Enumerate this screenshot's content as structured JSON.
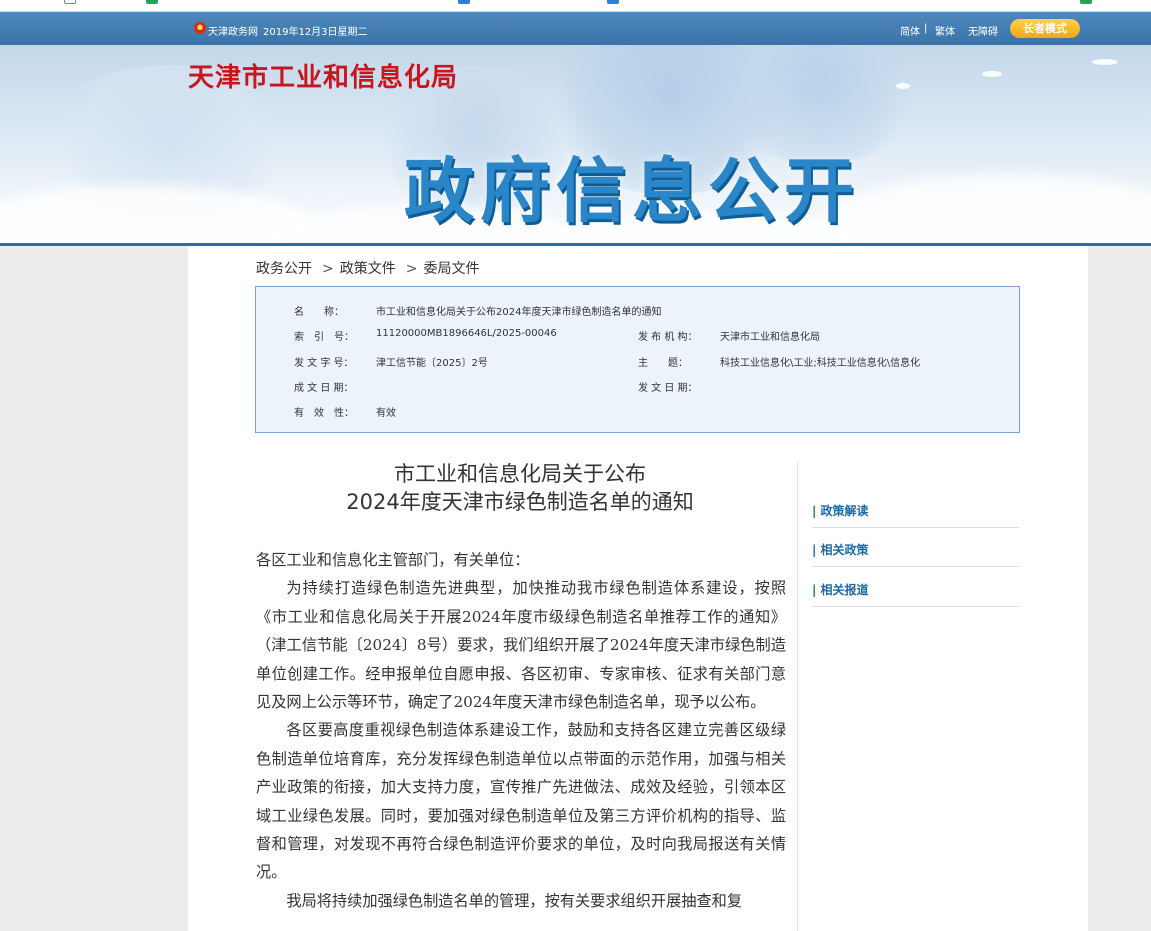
{
  "topbar": {
    "site_name": "天津政务网",
    "date": "2019年12月3日星期二",
    "lang_simplified": "简体",
    "lang_traditional": "繁体",
    "accessibility": "无障碍",
    "separator": "|",
    "elder_mode": "长者模式"
  },
  "banner": {
    "bureau": "天津市工业和信息化局",
    "title": "政府信息公开"
  },
  "breadcrumb": {
    "items": [
      "政务公开",
      "政策文件",
      "委局文件"
    ],
    "separator": ">"
  },
  "info": {
    "name_label": "名　　称：",
    "name_value": "市工业和信息化局关于公布2024年度天津市绿色制造名单的通知",
    "index_label": "索　引　号：",
    "index_value": "11120000MB1896646L/2025-00046",
    "publisher_label": "发 布 机 构：",
    "publisher_value": "天津市工业和信息化局",
    "docno_label": "发 文 字 号：",
    "docno_value": "津工信节能〔2025〕2号",
    "topic_label": "主　　题：",
    "topic_value": "科技工业信息化\\工业;科技工业信息化\\信息化",
    "created_label": "成 文 日 期：",
    "created_value": "",
    "issued_label": "发 文 日 期：",
    "issued_value": "",
    "validity_label": "有　效　性：",
    "validity_value": "有效"
  },
  "article": {
    "title_line1": "市工业和信息化局关于公布",
    "title_line2": "2024年度天津市绿色制造名单的通知",
    "greeting": "各区工业和信息化主管部门，有关单位：",
    "para1": "为持续打造绿色制造先进典型，加快推动我市绿色制造体系建设，按照《市工业和信息化局关于开展2024年度市级绿色制造名单推荐工作的通知》（津工信节能〔2024〕8号）要求，我们组织开展了2024年度天津市绿色制造单位创建工作。经申报单位自愿申报、各区初审、专家审核、征求有关部门意见及网上公示等环节，确定了2024年度天津市绿色制造名单，现予以公布。",
    "para2": "各区要高度重视绿色制造体系建设工作，鼓励和支持各区建立完善区级绿色制造单位培育库，充分发挥绿色制造单位以点带面的示范作用，加强与相关产业政策的衔接，加大支持力度，宣传推广先进做法、成效及经验，引领本区域工业绿色发展。同时，要加强对绿色制造单位及第三方评价机构的指导、监督和管理，对发现不再符合绿色制造评价要求的单位，及时向我局报送有关情况。",
    "para3": "我局将持续加强绿色制造名单的管理，按有关要求组织开展抽查和复"
  },
  "sidebar": {
    "policy_reading": "| 政策解读",
    "related_policy": "| 相关政策",
    "related_reports": "| 相关报道"
  }
}
